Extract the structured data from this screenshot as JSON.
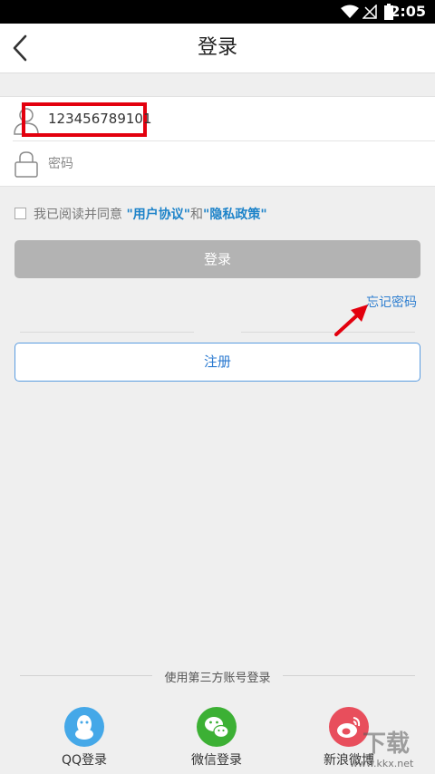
{
  "status_bar": {
    "time": "2:05"
  },
  "header": {
    "title": "登录"
  },
  "form": {
    "account_value": "123456789101",
    "password_placeholder": "密码"
  },
  "agreement": {
    "prefix": "我已阅读并同意",
    "user_agreement": "\"用户协议\"",
    "and": "和",
    "privacy_policy": "\"隐私政策\""
  },
  "buttons": {
    "login": "登录",
    "forgot_password": "忘记密码",
    "register": "注册"
  },
  "third_party": {
    "title": "使用第三方账号登录",
    "items": [
      {
        "label": "QQ登录",
        "icon": "qq-icon",
        "color": "#45a8e8"
      },
      {
        "label": "微信登录",
        "icon": "wechat-icon",
        "color": "#3cb034"
      },
      {
        "label": "新浪微博",
        "icon": "weibo-icon",
        "color": "#e84e5c"
      }
    ]
  },
  "watermark": {
    "line1": "下载",
    "line2": "www.kkx.net"
  }
}
